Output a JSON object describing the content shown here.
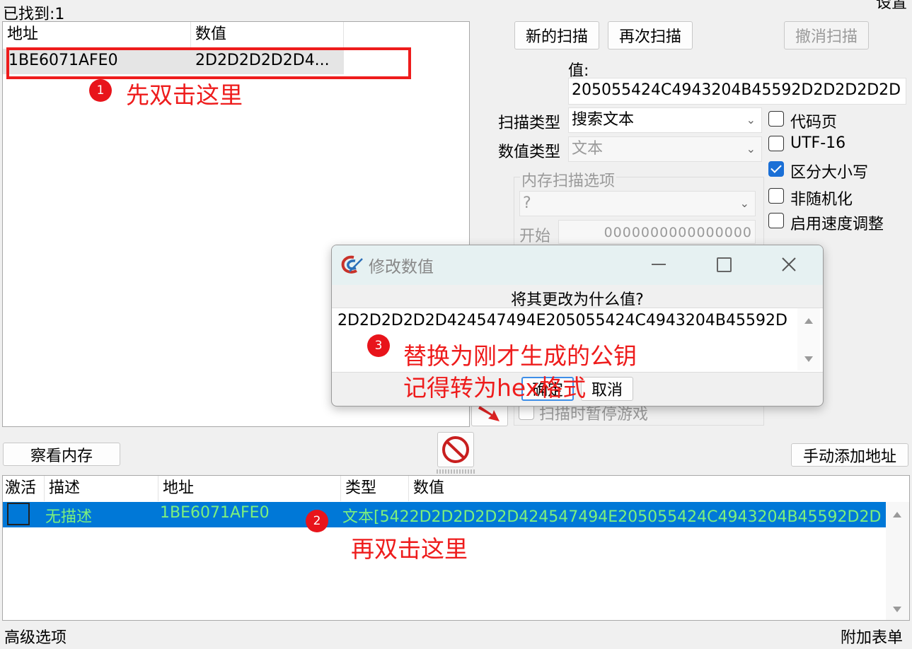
{
  "found_label": "已找到:1",
  "settings_label": "设置",
  "results": {
    "headers": [
      "地址",
      "数值"
    ],
    "rows": [
      {
        "address": "1BE6071AFE0",
        "value": "2D2D2D2D2D4..."
      }
    ]
  },
  "scan": {
    "new_scan": "新的扫描",
    "next_scan": "再次扫描",
    "undo_scan": "撤消扫描",
    "value_label": "值:",
    "value_input": "205055424C4943204B45592D2D2D2D2D",
    "scan_type_label": "扫描类型",
    "scan_type_value": "搜索文本",
    "value_type_label": "数值类型",
    "value_type_value": "文本",
    "memory_options_label": "内存扫描选项",
    "memory_region_value": "?",
    "start_label": "开始",
    "start_value": "0000000000000000",
    "pause_label": "扫描时暂停游戏"
  },
  "options": [
    {
      "label": "代码页",
      "checked": false
    },
    {
      "label": "UTF-16",
      "checked": false
    },
    {
      "label": "区分大小写",
      "checked": true
    },
    {
      "label": "非随机化",
      "checked": false
    },
    {
      "label": "启用速度调整",
      "checked": false
    }
  ],
  "dialog": {
    "title": "修改数值",
    "prompt": "将其更改为什么值?",
    "value": "2D2D2D2D2D424547494E205055424C4943204B45592D",
    "ok": "确定",
    "cancel": "取消"
  },
  "view_memory": "察看内存",
  "manual_add": "手动添加地址",
  "address_list": {
    "headers": [
      "激活",
      "描述",
      "地址",
      "类型",
      "数值"
    ],
    "rows": [
      {
        "description": "无描述",
        "address": "1BE6071AFE0",
        "typevalue": "文本[5422D2D2D2D2D424547494E205055424C4943204B45592D2D"
      }
    ]
  },
  "advanced_options": "高级选项",
  "table_extras": "附加表单",
  "annotations": {
    "a1_num": "1",
    "a1_text": "先双击这里",
    "a2_num": "2",
    "a2_text": "再双击这里",
    "a3_num": "3",
    "a3_line1": "替换为刚才生成的公钥",
    "a3_line2": "记得转为hex格式"
  },
  "colors": {
    "annotation_red": "#ee1c1c",
    "selection_blue": "#0078d7",
    "selected_text": "#7df07d"
  }
}
